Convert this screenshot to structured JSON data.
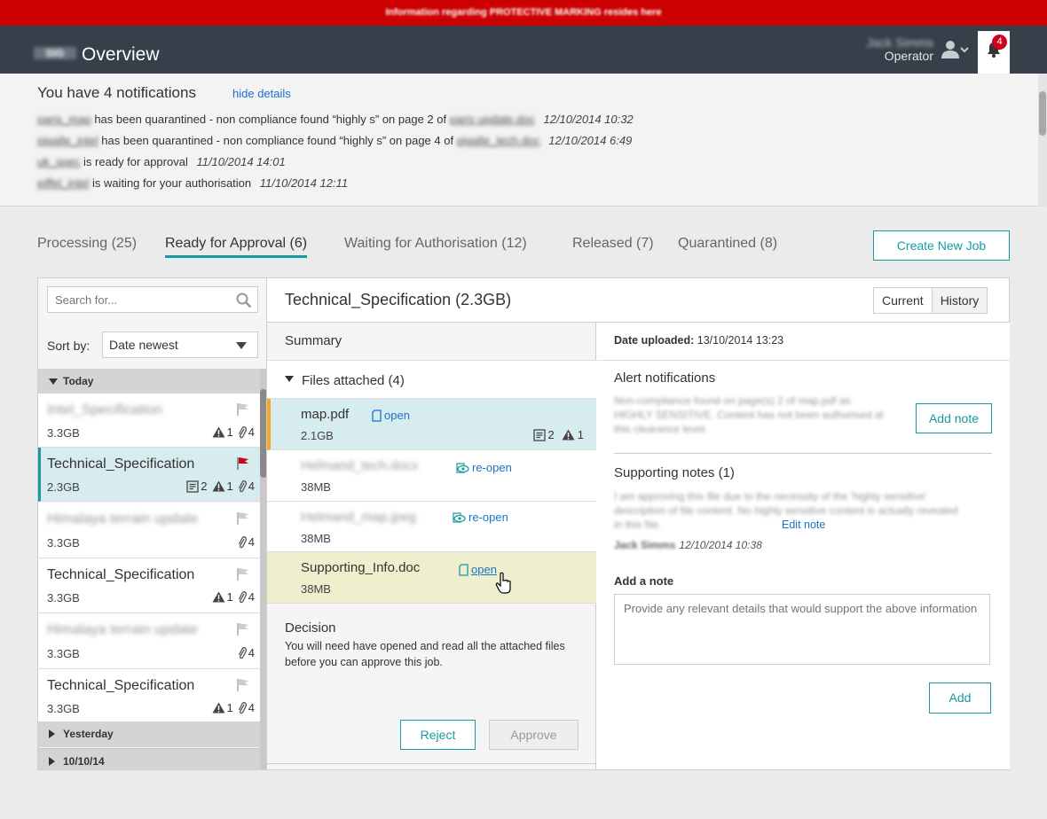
{
  "banner": {
    "text": "Information regarding PROTECTIVE MARKING resides here"
  },
  "header": {
    "logo_text": "SIG",
    "title": "Overview",
    "user_name": "Jack Simms",
    "user_role": "Operator",
    "notification_count": "4"
  },
  "notifications": {
    "title": "You have 4 notifications",
    "hide_label": "hide details",
    "items": [
      {
        "subject": "paris_map",
        "text": "has been quarantined - non compliance found “highly s” on page 2 of",
        "file": "paris update.doc",
        "date": "12/10/2014  10:32"
      },
      {
        "subject": "pigalle_intel",
        "text": "has been quarantined - non compliance found “highly s” on page 4 of",
        "file": "pigalle_tech.doc",
        "date": "12/10/2014  6:49"
      },
      {
        "subject": "uk_spec",
        "text": "is ready for approval",
        "file": "",
        "date": "11/10/2014  14:01"
      },
      {
        "subject": "eiffel_intel",
        "text": "is waiting for your authorisation",
        "file": "",
        "date": "11/10/2014  12:11"
      }
    ]
  },
  "tabs": [
    {
      "label": "Processing (25)"
    },
    {
      "label": "Ready for Approval (6)"
    },
    {
      "label": "Waiting for Authorisation (12)"
    },
    {
      "label": "Released (7)"
    },
    {
      "label": "Quarantined (8)"
    }
  ],
  "create_job_label": "Create New Job",
  "sidebar": {
    "search_placeholder": "Search for...",
    "sort_label": "Sort by:",
    "sort_value": "Date newest",
    "groups": [
      {
        "label": "Today"
      },
      {
        "label": "Yesterday"
      },
      {
        "label": "10/10/14"
      }
    ],
    "jobs": [
      {
        "name": "Intel_Specification",
        "size": "3.3GB",
        "notes": "",
        "alerts": "1",
        "attachments": "4"
      },
      {
        "name": "Technical_Specification",
        "size": "2.3GB",
        "notes": "2",
        "alerts": "1",
        "attachments": "4"
      },
      {
        "name": "Himalaya terrain update",
        "size": "3.3GB",
        "notes": "",
        "alerts": "",
        "attachments": "4"
      },
      {
        "name": "Technical_Specification",
        "size": "3.3GB",
        "notes": "",
        "alerts": "1",
        "attachments": "4"
      },
      {
        "name": "Himalaya terrain update",
        "size": "3.3GB",
        "notes": "",
        "alerts": "",
        "attachments": "4"
      },
      {
        "name": "Technical_Specification",
        "size": "3.3GB",
        "notes": "",
        "alerts": "1",
        "attachments": "4"
      }
    ]
  },
  "detail": {
    "title": "Technical_Specification (2.3GB)",
    "view_current": "Current",
    "view_history": "History",
    "summary_label": "Summary",
    "files_label": "Files attached (4)",
    "files": [
      {
        "name": "map.pdf",
        "size": "2.1GB",
        "action": "open",
        "notes": "2",
        "alerts": "1"
      },
      {
        "name": "Helmand_tech.docx",
        "size": "38MB",
        "action": "re-open"
      },
      {
        "name": "Helmand_map.jpeg",
        "size": "38MB",
        "action": "re-open"
      },
      {
        "name": "Supporting_Info.doc",
        "size": "38MB",
        "action": "open"
      }
    ],
    "decision_title": "Decision",
    "decision_text": "You will need have opened and read all the attached files before you can approve this job.",
    "reject_label": "Reject",
    "approve_label": "Approve",
    "date_uploaded_label": "Date uploaded:",
    "date_uploaded_value": "13/10/2014  13:23",
    "alert_title": "Alert notifications",
    "alert_text": "Non-compliance found on page(s) 2 of map.pdf as HIGHLY SENSITIVE. Content has not been authorised at this clearance level.",
    "add_note_label": "Add note",
    "supporting_title": "Supporting notes (1)",
    "supporting_text": "I am approving this file due to the necessity of the 'highly sensitive' description of file content. No highly sensitive content is actually revealed in this file.",
    "edit_note_label": "Edit note",
    "note_author": "Jack Simms",
    "note_date": "12/10/2014  10:38",
    "add_a_note_label": "Add a note",
    "note_placeholder": "Provide any relevant details that would support the above information",
    "add_label": "Add"
  }
}
